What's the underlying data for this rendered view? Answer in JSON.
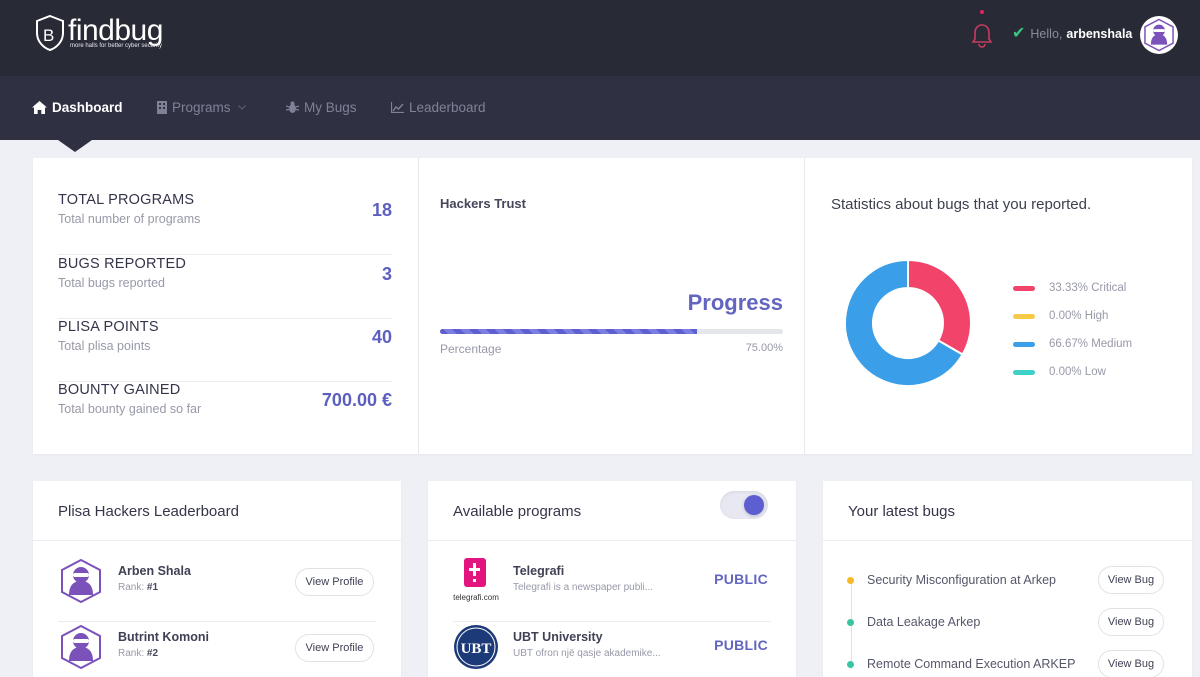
{
  "header": {
    "brand": "findbug",
    "tagline": "more halls for better cyber security",
    "greeting": "Hello,",
    "username": "arbenshala"
  },
  "nav": {
    "items": [
      {
        "label": "Dashboard",
        "active": true
      },
      {
        "label": "Programs",
        "has_dropdown": true
      },
      {
        "label": "My Bugs"
      },
      {
        "label": "Leaderboard"
      }
    ]
  },
  "stats": [
    {
      "title": "TOTAL PROGRAMS",
      "subtitle": "Total number of programs",
      "value": "18"
    },
    {
      "title": "BUGS REPORTED",
      "subtitle": "Total bugs reported",
      "value": "3"
    },
    {
      "title": "PLISA POINTS",
      "subtitle": "Total plisa points",
      "value": "40"
    },
    {
      "title": "BOUNTY GAINED",
      "subtitle": "Total bounty gained so far",
      "value": "700.00 €"
    }
  ],
  "trust": {
    "title": "Hackers Trust",
    "progress_label": "Progress",
    "percentage_label": "Percentage",
    "percentage_value": "75.00%",
    "percentage": 0.75
  },
  "bug_stats": {
    "title": "Statistics about bugs that you reported.",
    "legend": [
      {
        "label": "33.33% Critical",
        "value": 33.33,
        "color": "#f2436a"
      },
      {
        "label": "0.00% High",
        "value": 0,
        "color": "#f7c948"
      },
      {
        "label": "66.67% Medium",
        "value": 66.67,
        "color": "#3b9ee9"
      },
      {
        "label": "0.00% Low",
        "value": 0,
        "color": "#3dcfc8"
      }
    ]
  },
  "chart_data": {
    "type": "pie",
    "title": "Statistics about bugs that you reported.",
    "categories": [
      "Critical",
      "High",
      "Medium",
      "Low"
    ],
    "values": [
      33.33,
      0.0,
      66.67,
      0.0
    ]
  },
  "leaderboard": {
    "title": "Plisa Hackers Leaderboard",
    "rank_prefix": "Rank:",
    "button_label": "View Profile",
    "rows": [
      {
        "name": "Arben Shala",
        "rank": "#1"
      },
      {
        "name": "Butrint Komoni",
        "rank": "#2"
      }
    ]
  },
  "programs": {
    "title": "Available programs",
    "toggle_on": true,
    "rows": [
      {
        "name": "Telegrafi",
        "description": "Telegrafi is a newspaper publi...",
        "badge": "PUBLIC",
        "logo_text": "telegrafi.com"
      },
      {
        "name": "UBT University",
        "description": "UBT ofron një qasje akademike...",
        "badge": "PUBLIC",
        "logo_text": "UBT"
      }
    ]
  },
  "latest_bugs": {
    "title": "Your latest bugs",
    "button_label": "View Bug",
    "rows": [
      {
        "title": "Security Misconfiguration at Arkep",
        "color": "#f7b924"
      },
      {
        "title": "Data Leakage Arkep",
        "color": "#3ac4a0"
      },
      {
        "title": "Remote Command Execution ARKEP",
        "color": "#3ac4a0"
      }
    ]
  }
}
